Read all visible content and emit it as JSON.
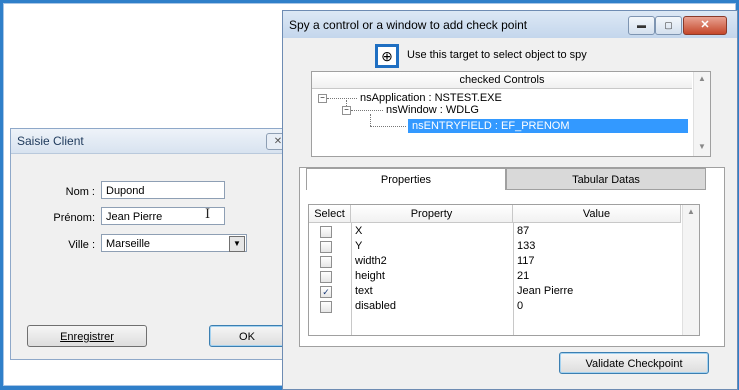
{
  "client_dialog": {
    "title": "Saisie Client",
    "close_label": "✕",
    "fields": [
      {
        "label": "Nom :",
        "value": "Dupond"
      },
      {
        "label": "Prénom:",
        "value": "Jean Pierre"
      },
      {
        "label": "Ville :",
        "value": "Marseille"
      }
    ],
    "combo_arrow": "▼",
    "ibeam": "I",
    "buttons": {
      "save": "Enregistrer",
      "ok": "OK"
    }
  },
  "spy_window": {
    "title": "Spy a control or a window to add check point",
    "window_buttons": {
      "minimize": "▬",
      "maximize": "▢",
      "close": "✕"
    },
    "target_icon": "crosshair-icon",
    "target_glyph": "⊕",
    "target_label": "Use this target to select object to spy",
    "tree": {
      "header": "checked Controls",
      "nodes": [
        {
          "expander": "−",
          "label": "nsApplication : NSTEST.EXE"
        },
        {
          "expander": "−",
          "label": "nsWindow : WDLG"
        },
        {
          "label": "nsENTRYFIELD : EF_PRENOM",
          "selected": true
        }
      ],
      "scroll_up": "▲",
      "scroll_down": "▼"
    },
    "tabs": [
      "Properties",
      "Tabular Datas"
    ],
    "properties_grid": {
      "columns": [
        "Select",
        "Property",
        "Value"
      ],
      "rows": [
        {
          "checked": false,
          "property": "X",
          "value": "87"
        },
        {
          "checked": false,
          "property": "Y",
          "value": "133"
        },
        {
          "checked": false,
          "property": "width2",
          "value": "117"
        },
        {
          "checked": false,
          "property": "height",
          "value": "21"
        },
        {
          "checked": true,
          "property": "text",
          "value": "Jean Pierre"
        },
        {
          "checked": false,
          "property": "disabled",
          "value": "0"
        }
      ],
      "check_mark": "✓",
      "scroll_up": "▲"
    },
    "validate_button": "Validate Checkpoint"
  },
  "colors": {
    "frame_blue": "#2f7fc9",
    "selection": "#3399ff",
    "target_border": "#1f6fc2"
  }
}
